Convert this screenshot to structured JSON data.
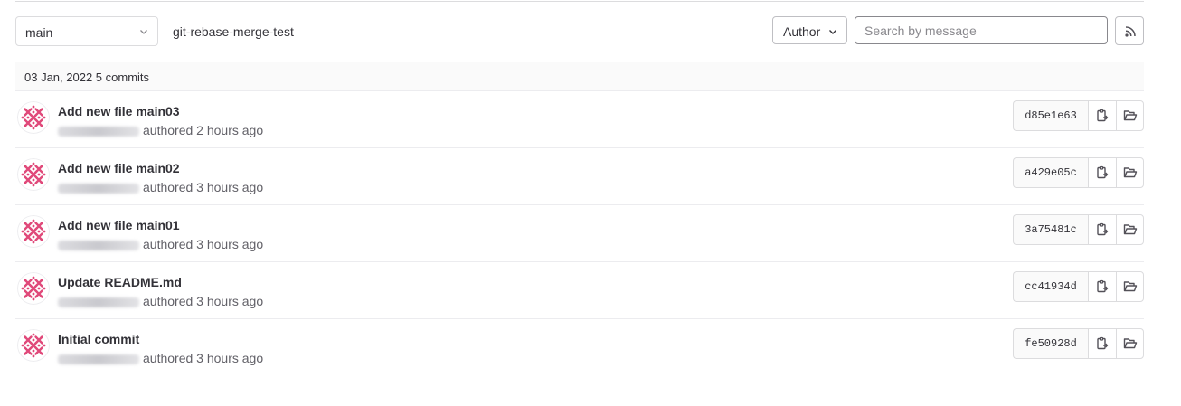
{
  "toolbar": {
    "branch": "main",
    "project": "git-rebase-merge-test",
    "author_label": "Author",
    "search_placeholder": "Search by message"
  },
  "day_header": "03 Jan, 2022 5 commits",
  "colors": {
    "avatar_accent": "#e0497a",
    "border": "#dcdcde"
  },
  "commits": [
    {
      "title": "Add new file main03",
      "meta": "authored 2 hours ago",
      "sha": "d85e1e63"
    },
    {
      "title": "Add new file main02",
      "meta": "authored 3 hours ago",
      "sha": "a429e05c"
    },
    {
      "title": "Add new file main01",
      "meta": "authored 3 hours ago",
      "sha": "3a75481c"
    },
    {
      "title": "Update README.md",
      "meta": "authored 3 hours ago",
      "sha": "cc41934d"
    },
    {
      "title": "Initial commit",
      "meta": "authored 3 hours ago",
      "sha": "fe50928d"
    }
  ]
}
